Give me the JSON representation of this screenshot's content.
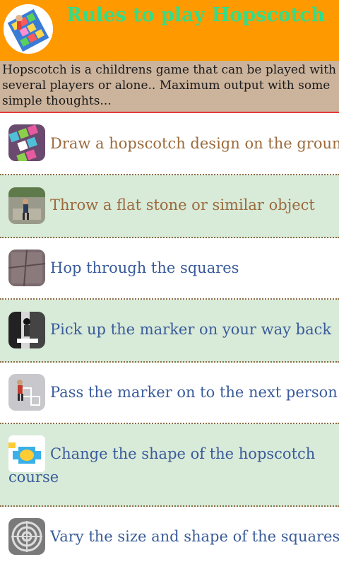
{
  "app": {
    "title": "Rules to play Hopscotch",
    "intro": "Hopscotch is a childrens game that can be played with several players or alone.. Maximum output with some simple thoughts..."
  },
  "colors": {
    "header_bg": "#ff9900",
    "title_text": "#33dd88",
    "intro_bg": "#ccb39c",
    "divider_red": "#e43a3a",
    "row_green": "#d8ead8",
    "text_brown": "#9b6b3d",
    "text_blue": "#3a5c9a"
  },
  "items": [
    {
      "label": "Draw a hopscotch design on the ground",
      "icon": "hopscotch-drawing-thumbnail"
    },
    {
      "label": "Throw a flat stone or similar object",
      "icon": "child-throwing-thumbnail"
    },
    {
      "label": "Hop through the squares",
      "icon": "hopping-thumbnail"
    },
    {
      "label": "Pick up the marker on your way back",
      "icon": "pickup-marker-thumbnail"
    },
    {
      "label": "Pass the marker on to the next person",
      "icon": "pass-marker-thumbnail"
    },
    {
      "label_line1": "Change the shape of the hopscotch",
      "label_line2": "course",
      "icon": "course-shape-thumbnail"
    },
    {
      "label": "Vary the size and shape of the squares",
      "icon": "spiral-squares-thumbnail"
    }
  ]
}
